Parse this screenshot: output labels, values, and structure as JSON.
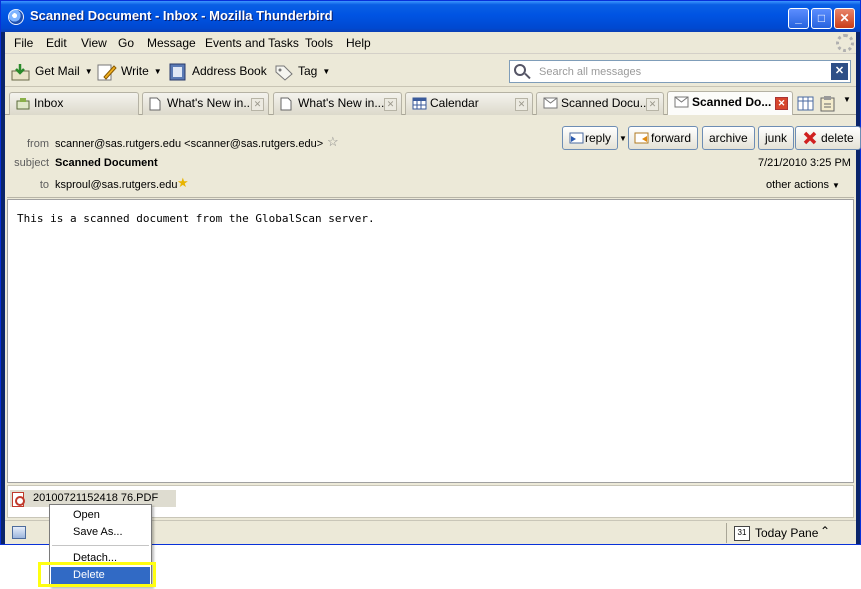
{
  "window": {
    "title": "Scanned Document - Inbox - Mozilla Thunderbird"
  },
  "menu": [
    "File",
    "Edit",
    "View",
    "Go",
    "Message",
    "Events and Tasks",
    "Tools",
    "Help"
  ],
  "toolbar": {
    "get_mail": "Get Mail",
    "write": "Write",
    "address_book": "Address Book",
    "tag": "Tag",
    "search_placeholder": "Search all messages"
  },
  "tabs": [
    {
      "label": "Inbox",
      "icon": "inbox-icon",
      "active": false
    },
    {
      "label": "What's New in...",
      "icon": "page-icon",
      "active": false
    },
    {
      "label": "What's New in...",
      "icon": "page-icon",
      "active": false
    },
    {
      "label": "Calendar",
      "icon": "calendar-icon",
      "active": false
    },
    {
      "label": "Scanned Docu...",
      "icon": "envelope-icon",
      "active": false
    },
    {
      "label": "Scanned Do...",
      "icon": "envelope-icon",
      "active": true
    }
  ],
  "message": {
    "from_label": "from",
    "from": "scanner@sas.rutgers.edu <scanner@sas.rutgers.edu>",
    "subject_label": "subject",
    "subject": "Scanned Document",
    "to_label": "to",
    "to": "ksproul@sas.rutgers.edu",
    "date": "7/21/2010 3:25 PM",
    "other_actions": "other actions",
    "body": "This is a scanned document from the GlobalScan server."
  },
  "actions": {
    "reply": "reply",
    "forward": "forward",
    "archive": "archive",
    "junk": "junk",
    "delete": "delete"
  },
  "attachment": {
    "name": "20100721152418 76.PDF"
  },
  "statusbar": {
    "today_pane": "Today Pane",
    "calendar_day": "31"
  },
  "context_menu": {
    "items": [
      "Open",
      "Save As...",
      "Detach...",
      "Delete"
    ],
    "highlighted": "Delete"
  }
}
